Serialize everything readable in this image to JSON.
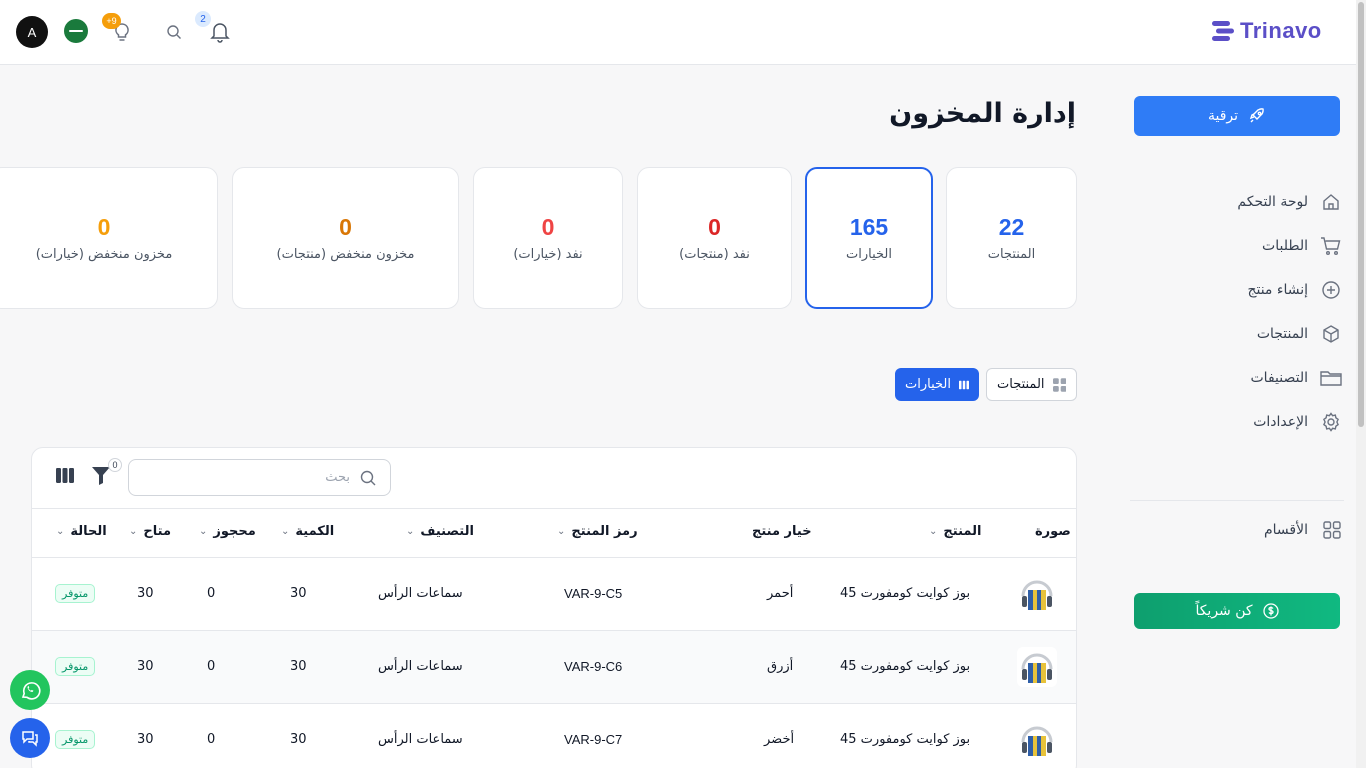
{
  "app": {
    "logo_text": "Trinavo"
  },
  "topbar": {
    "avatar_letter": "A",
    "ideas_badge": "+9",
    "notifications_badge": "2"
  },
  "sidebar": {
    "upgrade_label": "ترقية",
    "items": [
      {
        "label": "لوحة التحكم",
        "icon": "home-icon"
      },
      {
        "label": "الطلبات",
        "icon": "cart-icon"
      },
      {
        "label": "إنشاء منتج",
        "icon": "plus-circle-icon"
      },
      {
        "label": "المنتجات",
        "icon": "box-icon"
      },
      {
        "label": "التصنيفات",
        "icon": "folder-icon"
      },
      {
        "label": "الإعدادات",
        "icon": "gear-icon"
      }
    ],
    "sections_label": "الأقسام",
    "partner_label": "كن شريكاً"
  },
  "main": {
    "title": "إدارة المخزون",
    "stats": [
      {
        "value": "22",
        "label": "المنتجات",
        "color": "#2563eb"
      },
      {
        "value": "165",
        "label": "الخيارات",
        "color": "#2563eb"
      },
      {
        "value": "0",
        "label": "نفد (منتجات)",
        "color": "#dc2626"
      },
      {
        "value": "0",
        "label": "نفد (خيارات)",
        "color": "#ef4444"
      },
      {
        "value": "0",
        "label": "مخزون منخفض (منتجات)",
        "color": "#d97706"
      },
      {
        "value": "0",
        "label": "مخزون منخفض (خيارات)",
        "color": "#f59e0b"
      }
    ],
    "view_toggle": {
      "products_label": "المنتجات",
      "variants_label": "الخيارات"
    }
  },
  "table": {
    "search_placeholder": "بحث",
    "filter_count": "0",
    "headers": {
      "image": "صورة",
      "product": "المنتج",
      "variant": "خيار منتج",
      "sku": "رمز المنتج",
      "category": "التصنيف",
      "quantity": "الكمية",
      "reserved": "محجوز",
      "available": "متاح",
      "status": "الحالة"
    },
    "rows": [
      {
        "product": "بوز كوايت كومفورت 45",
        "variant": "أحمر",
        "sku": "VAR-9-C5",
        "category": "سماعات الرأس",
        "quantity": "30",
        "reserved": "0",
        "available": "30",
        "status": "متوفر"
      },
      {
        "product": "بوز كوايت كومفورت 45",
        "variant": "أزرق",
        "sku": "VAR-9-C6",
        "category": "سماعات الرأس",
        "quantity": "30",
        "reserved": "0",
        "available": "30",
        "status": "متوفر"
      },
      {
        "product": "بوز كوايت كومفورت 45",
        "variant": "أخضر",
        "sku": "VAR-9-C7",
        "category": "سماعات الرأس",
        "quantity": "30",
        "reserved": "0",
        "available": "30",
        "status": "متوفر"
      }
    ]
  },
  "colors": {
    "primary": "#2563eb",
    "accent_purple": "#5b4fc7",
    "success": "#10b981",
    "whatsapp": "#22c55e"
  }
}
